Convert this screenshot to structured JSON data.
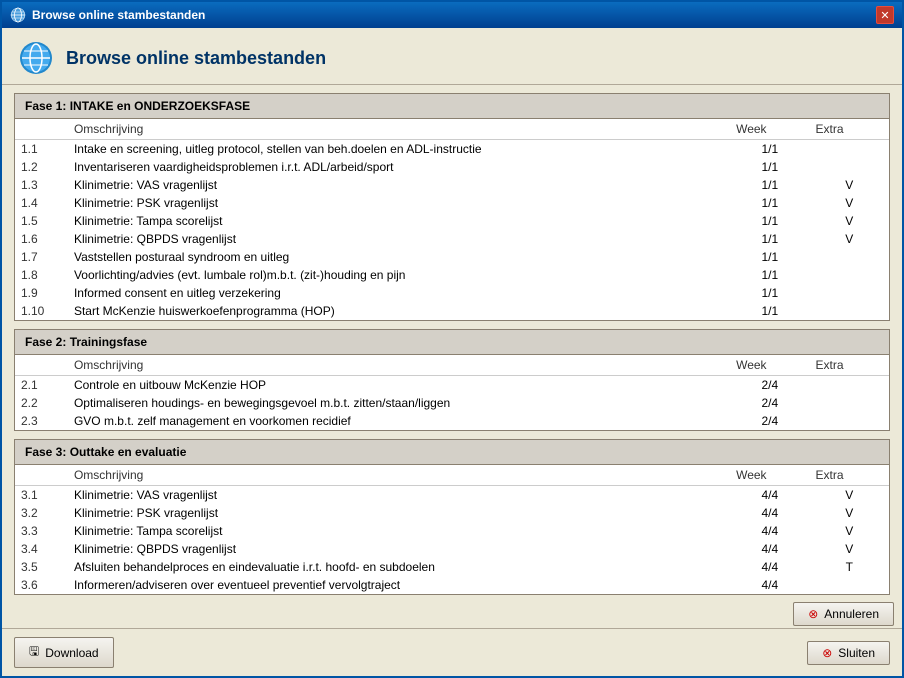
{
  "window": {
    "title": "Browse online stambestanden",
    "header_title": "Browse online stambestanden"
  },
  "buttons": {
    "download": "Download",
    "sluiten": "Sluiten",
    "annuleren": "Annuleren",
    "close_x": "✕"
  },
  "phases": [
    {
      "id": "phase1",
      "title": "Fase 1: INTAKE en ONDERZOEKSFASE",
      "col_omschrijving": "Omschrijving",
      "col_week": "Week",
      "col_extra": "Extra",
      "rows": [
        {
          "num": "1.1",
          "desc": "Intake en screening, uitleg protocol, stellen van beh.doelen en ADL-instructie",
          "week": "1/1",
          "extra": ""
        },
        {
          "num": "1.2",
          "desc": "Inventariseren vaardigheidsproblemen i.r.t. ADL/arbeid/sport",
          "week": "1/1",
          "extra": ""
        },
        {
          "num": "1.3",
          "desc": "Klinimetrie: VAS vragenlijst",
          "week": "1/1",
          "extra": "V"
        },
        {
          "num": "1.4",
          "desc": "Klinimetrie: PSK vragenlijst",
          "week": "1/1",
          "extra": "V"
        },
        {
          "num": "1.5",
          "desc": "Klinimetrie: Tampa scorelijst",
          "week": "1/1",
          "extra": "V"
        },
        {
          "num": "1.6",
          "desc": "Klinimetrie: QBPDS vragenlijst",
          "week": "1/1",
          "extra": "V"
        },
        {
          "num": "1.7",
          "desc": "Vaststellen posturaal syndroom en uitleg",
          "week": "1/1",
          "extra": ""
        },
        {
          "num": "1.8",
          "desc": "Voorlichting/advies (evt. lumbale rol)m.b.t. (zit-)houding en pijn",
          "week": "1/1",
          "extra": ""
        },
        {
          "num": "1.9",
          "desc": "Informed consent en uitleg verzekering",
          "week": "1/1",
          "extra": ""
        },
        {
          "num": "1.10",
          "desc": "Start McKenzie huiswerkoefenprogramma (HOP)",
          "week": "1/1",
          "extra": ""
        }
      ]
    },
    {
      "id": "phase2",
      "title": "Fase 2: Trainingsfase",
      "col_omschrijving": "Omschrijving",
      "col_week": "Week",
      "col_extra": "Extra",
      "rows": [
        {
          "num": "2.1",
          "desc": "Controle en uitbouw McKenzie HOP",
          "week": "2/4",
          "extra": ""
        },
        {
          "num": "2.2",
          "desc": "Optimaliseren houdings- en bewegingsgevoel m.b.t. zitten/staan/liggen",
          "week": "2/4",
          "extra": ""
        },
        {
          "num": "2.3",
          "desc": "GVO m.b.t. zelf management en voorkomen recidief",
          "week": "2/4",
          "extra": ""
        }
      ]
    },
    {
      "id": "phase3",
      "title": "Fase 3: Outtake en evaluatie",
      "col_omschrijving": "Omschrijving",
      "col_week": "Week",
      "col_extra": "Extra",
      "rows": [
        {
          "num": "3.1",
          "desc": "Klinimetrie: VAS vragenlijst",
          "week": "4/4",
          "extra": "V"
        },
        {
          "num": "3.2",
          "desc": "Klinimetrie: PSK vragenlijst",
          "week": "4/4",
          "extra": "V"
        },
        {
          "num": "3.3",
          "desc": "Klinimetrie: Tampa scorelijst",
          "week": "4/4",
          "extra": "V"
        },
        {
          "num": "3.4",
          "desc": "Klinimetrie: QBPDS vragenlijst",
          "week": "4/4",
          "extra": "V"
        },
        {
          "num": "3.5",
          "desc": "Afsluiten behandelproces en eindevaluatie i.r.t. hoofd- en subdoelen",
          "week": "4/4",
          "extra": "T"
        },
        {
          "num": "3.6",
          "desc": "Informeren/adviseren over eventueel preventief vervolgtraject",
          "week": "4/4",
          "extra": ""
        }
      ]
    }
  ]
}
